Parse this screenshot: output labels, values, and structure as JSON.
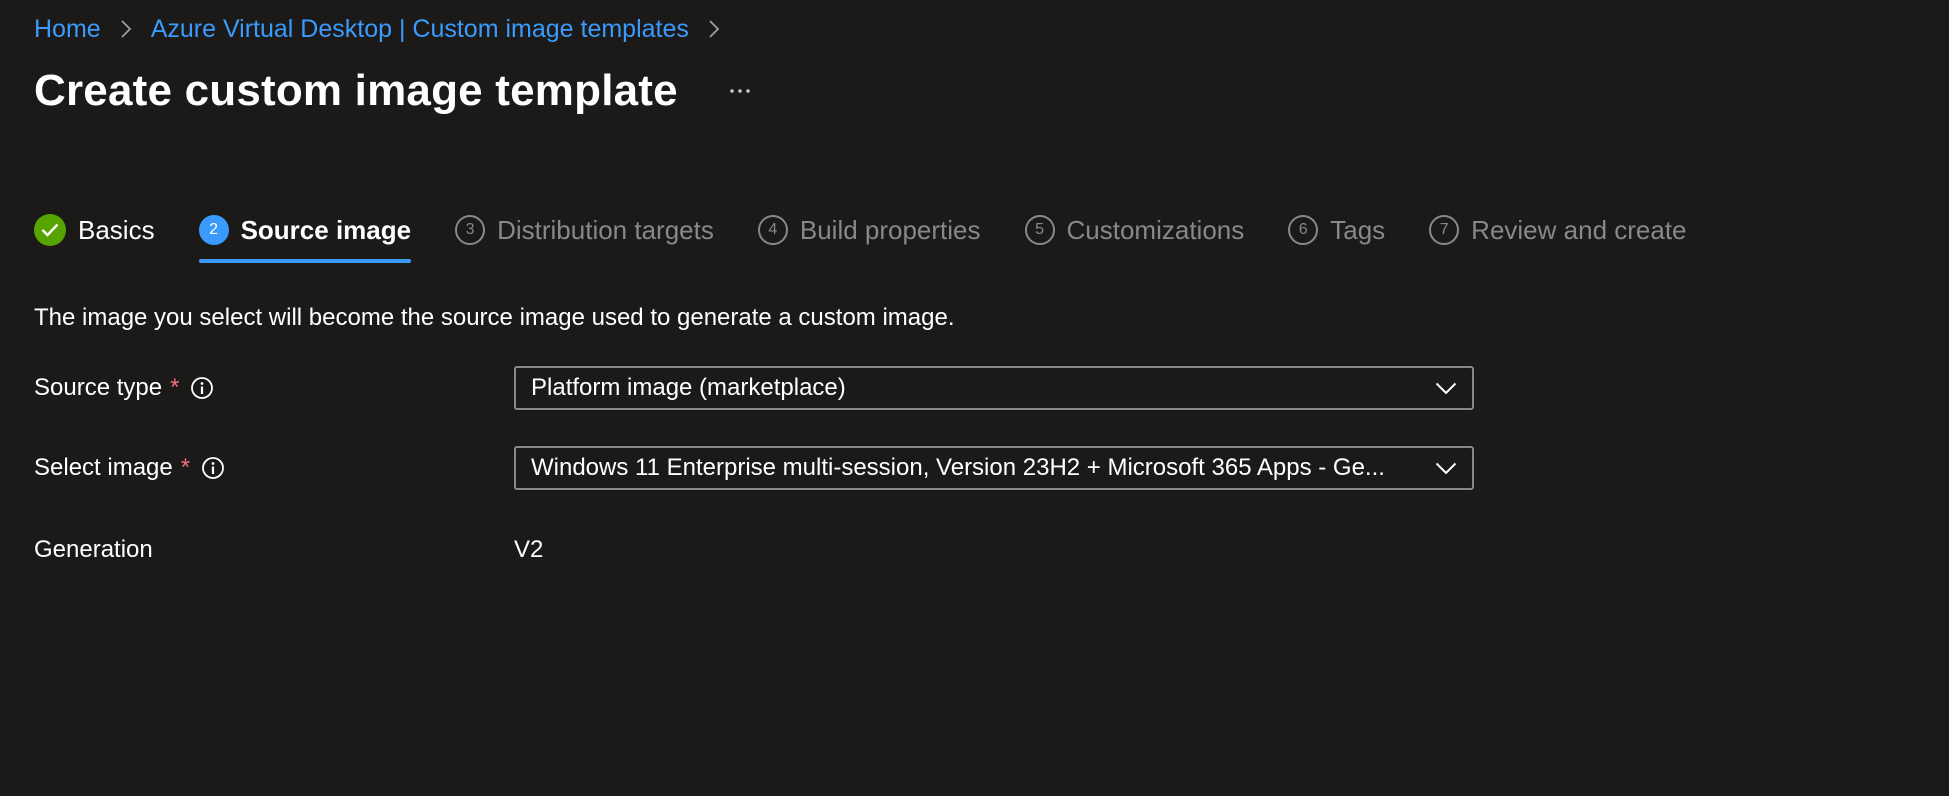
{
  "breadcrumb": {
    "items": [
      "Home",
      "Azure Virtual Desktop | Custom image templates"
    ]
  },
  "header": {
    "title": "Create custom image template",
    "more_icon": "ellipsis-icon"
  },
  "wizard": {
    "tabs": [
      {
        "step": "",
        "label": "Basics",
        "state": "completed",
        "icon": "checkmark-icon"
      },
      {
        "step": "2",
        "label": "Source image",
        "state": "active"
      },
      {
        "step": "3",
        "label": "Distribution targets",
        "state": "inactive"
      },
      {
        "step": "4",
        "label": "Build properties",
        "state": "inactive"
      },
      {
        "step": "5",
        "label": "Customizations",
        "state": "inactive"
      },
      {
        "step": "6",
        "label": "Tags",
        "state": "inactive"
      },
      {
        "step": "7",
        "label": "Review and create",
        "state": "inactive"
      }
    ]
  },
  "main": {
    "description": "The image you select will become the source image used to generate a custom image.",
    "fields": {
      "source_type": {
        "label": "Source type",
        "required_mark": "*",
        "value": "Platform image (marketplace)"
      },
      "select_image": {
        "label": "Select image",
        "required_mark": "*",
        "value": "Windows 11 Enterprise multi-session, Version 23H2 + Microsoft 365 Apps - Ge..."
      },
      "generation": {
        "label": "Generation",
        "value": "V2"
      }
    }
  },
  "colors": {
    "background": "#1b1a19",
    "link": "#3a9bfc",
    "accent": "#3a9bfc",
    "success": "#57a300",
    "required": "#f1707b",
    "muted": "#8a8886"
  }
}
